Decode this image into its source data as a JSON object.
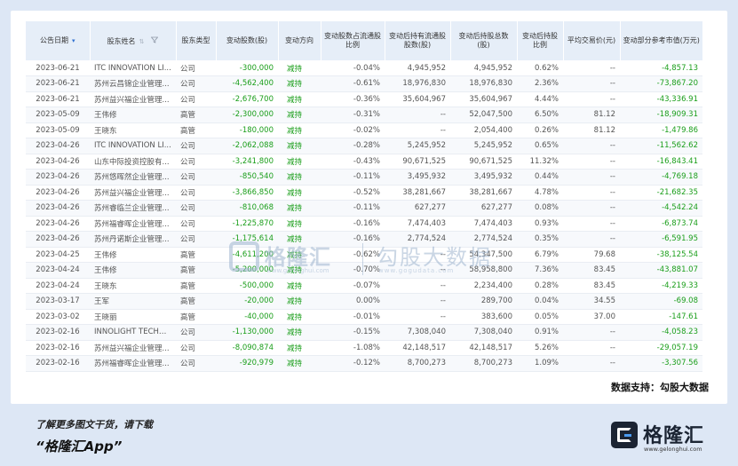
{
  "table": {
    "headers": {
      "date": "公告日期",
      "holder": "股东姓名",
      "type": "股东类型",
      "change": "变动股数(股)",
      "direction": "变动方向",
      "ratio": "变动股数占流通股比例",
      "after_float": "变动后持有流通股股数(股)",
      "after_total": "变动后持股总数(股)",
      "after_pct": "变动后持股比例",
      "avg_price": "平均交易价(元)",
      "value": "变动部分参考市值(万元)"
    },
    "rows": [
      {
        "date": "2023-06-21",
        "holder": "ITC INNOVATION LI...",
        "type": "公司",
        "change": "-300,000",
        "direction": "减持",
        "ratio": "-0.04%",
        "after_float": "4,945,952",
        "after_total": "4,945,952",
        "after_pct": "0.62%",
        "avg_price": "--",
        "value": "-4,857.13"
      },
      {
        "date": "2023-06-21",
        "holder": "苏州云昌锦企业管理...",
        "type": "公司",
        "change": "-4,562,400",
        "direction": "减持",
        "ratio": "-0.61%",
        "after_float": "18,976,830",
        "after_total": "18,976,830",
        "after_pct": "2.36%",
        "avg_price": "--",
        "value": "-73,867.20"
      },
      {
        "date": "2023-06-21",
        "holder": "苏州益兴福企业管理...",
        "type": "公司",
        "change": "-2,676,700",
        "direction": "减持",
        "ratio": "-0.36%",
        "after_float": "35,604,967",
        "after_total": "35,604,967",
        "after_pct": "4.44%",
        "avg_price": "--",
        "value": "-43,336.91"
      },
      {
        "date": "2023-05-09",
        "holder": "王伟修",
        "type": "高管",
        "change": "-2,300,000",
        "direction": "减持",
        "ratio": "-0.31%",
        "after_float": "--",
        "after_total": "52,047,500",
        "after_pct": "6.50%",
        "avg_price": "81.12",
        "value": "-18,909.31"
      },
      {
        "date": "2023-05-09",
        "holder": "王晓东",
        "type": "高管",
        "change": "-180,000",
        "direction": "减持",
        "ratio": "-0.02%",
        "after_float": "--",
        "after_total": "2,054,400",
        "after_pct": "0.26%",
        "avg_price": "81.12",
        "value": "-1,479.86"
      },
      {
        "date": "2023-04-26",
        "holder": "ITC INNOVATION LI...",
        "type": "公司",
        "change": "-2,062,088",
        "direction": "减持",
        "ratio": "-0.28%",
        "after_float": "5,245,952",
        "after_total": "5,245,952",
        "after_pct": "0.65%",
        "avg_price": "--",
        "value": "-11,562.62"
      },
      {
        "date": "2023-04-26",
        "holder": "山东中际投资控股有...",
        "type": "公司",
        "change": "-3,241,800",
        "direction": "减持",
        "ratio": "-0.43%",
        "after_float": "90,671,525",
        "after_total": "90,671,525",
        "after_pct": "11.32%",
        "avg_price": "--",
        "value": "-16,843.41"
      },
      {
        "date": "2023-04-26",
        "holder": "苏州悠晖然企业管理...",
        "type": "公司",
        "change": "-850,540",
        "direction": "减持",
        "ratio": "-0.11%",
        "after_float": "3,495,932",
        "after_total": "3,495,932",
        "after_pct": "0.44%",
        "avg_price": "--",
        "value": "-4,769.18"
      },
      {
        "date": "2023-04-26",
        "holder": "苏州益兴福企业管理...",
        "type": "公司",
        "change": "-3,866,850",
        "direction": "减持",
        "ratio": "-0.52%",
        "after_float": "38,281,667",
        "after_total": "38,281,667",
        "after_pct": "4.78%",
        "avg_price": "--",
        "value": "-21,682.35"
      },
      {
        "date": "2023-04-26",
        "holder": "苏州睿临兰企业管理...",
        "type": "公司",
        "change": "-810,068",
        "direction": "减持",
        "ratio": "-0.11%",
        "after_float": "627,277",
        "after_total": "627,277",
        "after_pct": "0.08%",
        "avg_price": "--",
        "value": "-4,542.24"
      },
      {
        "date": "2023-04-26",
        "holder": "苏州福睿晖企业管理...",
        "type": "公司",
        "change": "-1,225,870",
        "direction": "减持",
        "ratio": "-0.16%",
        "after_float": "7,474,403",
        "after_total": "7,474,403",
        "after_pct": "0.93%",
        "avg_price": "--",
        "value": "-6,873.74"
      },
      {
        "date": "2023-04-26",
        "holder": "苏州丹诺斯企业管理...",
        "type": "公司",
        "change": "-1,175,614",
        "direction": "减持",
        "ratio": "-0.16%",
        "after_float": "2,774,524",
        "after_total": "2,774,524",
        "after_pct": "0.35%",
        "avg_price": "--",
        "value": "-6,591.95"
      },
      {
        "date": "2023-04-25",
        "holder": "王伟修",
        "type": "高管",
        "change": "-4,611,200",
        "direction": "减持",
        "ratio": "-0.62%",
        "after_float": "--",
        "after_total": "54,347,500",
        "after_pct": "6.79%",
        "avg_price": "79.68",
        "value": "-38,125.54"
      },
      {
        "date": "2023-04-24",
        "holder": "王伟修",
        "type": "高管",
        "change": "-5,200,000",
        "direction": "减持",
        "ratio": "-0.70%",
        "after_float": "--",
        "after_total": "58,958,800",
        "after_pct": "7.36%",
        "avg_price": "83.45",
        "value": "-43,881.07"
      },
      {
        "date": "2023-04-24",
        "holder": "王晓东",
        "type": "高管",
        "change": "-500,000",
        "direction": "减持",
        "ratio": "-0.07%",
        "after_float": "--",
        "after_total": "2,234,400",
        "after_pct": "0.28%",
        "avg_price": "83.45",
        "value": "-4,219.33"
      },
      {
        "date": "2023-03-17",
        "holder": "王军",
        "type": "高管",
        "change": "-20,000",
        "direction": "减持",
        "ratio": "0.00%",
        "after_float": "--",
        "after_total": "289,700",
        "after_pct": "0.04%",
        "avg_price": "34.55",
        "value": "-69.08"
      },
      {
        "date": "2023-03-02",
        "holder": "王晓丽",
        "type": "高管",
        "change": "-40,000",
        "direction": "减持",
        "ratio": "-0.01%",
        "after_float": "--",
        "after_total": "383,600",
        "after_pct": "0.05%",
        "avg_price": "37.00",
        "value": "-147.61"
      },
      {
        "date": "2023-02-16",
        "holder": "INNOLIGHT TECHN...",
        "type": "公司",
        "change": "-1,130,000",
        "direction": "减持",
        "ratio": "-0.15%",
        "after_float": "7,308,040",
        "after_total": "7,308,040",
        "after_pct": "0.91%",
        "avg_price": "--",
        "value": "-4,058.23"
      },
      {
        "date": "2023-02-16",
        "holder": "苏州益兴福企业管理...",
        "type": "公司",
        "change": "-8,090,874",
        "direction": "减持",
        "ratio": "-1.08%",
        "after_float": "42,148,517",
        "after_total": "42,148,517",
        "after_pct": "5.26%",
        "avg_price": "--",
        "value": "-29,057.19"
      },
      {
        "date": "2023-02-16",
        "holder": "苏州福睿晖企业管理...",
        "type": "公司",
        "change": "-920,979",
        "direction": "减持",
        "ratio": "-0.12%",
        "after_float": "8,700,273",
        "after_total": "8,700,273",
        "after_pct": "1.09%",
        "avg_price": "--",
        "value": "-3,307.56"
      }
    ]
  },
  "source_text": "数据支持：勾股大数据",
  "watermark": {
    "brand": "格隆汇",
    "brand_url": "www.gelonghui.com",
    "data_brand": "勾股大数据",
    "data_url": "www.gogudata.com"
  },
  "footer": {
    "line1": "了解更多图文干货，请下载",
    "line2": "“格隆汇App”",
    "brand_name": "格隆汇",
    "brand_url": "www.gelonghui.com"
  },
  "colors": {
    "background": "#dde7f5",
    "header": "#e6eef8",
    "green": "#1a9e1a",
    "brand_dark": "#1b2433"
  }
}
